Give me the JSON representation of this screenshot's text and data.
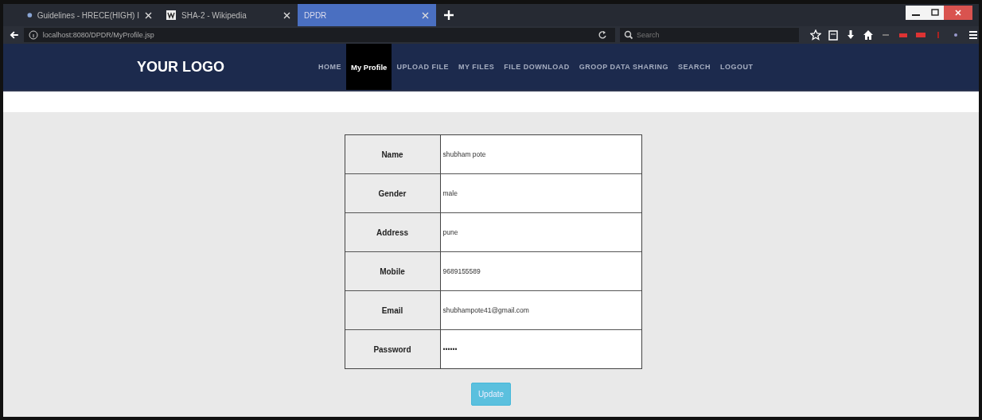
{
  "browser": {
    "tabs": [
      {
        "title": "Guidelines - HRECE(HIGH) I",
        "selected": false
      },
      {
        "title": "SHA-2 - Wikipedia",
        "selected": false
      },
      {
        "title": "DPDR",
        "selected": true
      }
    ],
    "url": "localhost:8080/DPDR/MyProfile.jsp",
    "search": {
      "placeholder": "Search"
    }
  },
  "site": {
    "logo": "YOUR LOGO",
    "nav": [
      {
        "label": "HOME",
        "selected": false
      },
      {
        "label": "My Profile",
        "selected": true
      },
      {
        "label": "UPLOAD FILE",
        "selected": false
      },
      {
        "label": "MY FILES",
        "selected": false
      },
      {
        "label": "FILE DOWNLOAD",
        "selected": false
      },
      {
        "label": "GROOP DATA SHARING",
        "selected": false
      },
      {
        "label": "SEARCH",
        "selected": false
      },
      {
        "label": "LOGOUT",
        "selected": false
      }
    ]
  },
  "profile": {
    "rows": [
      {
        "label": "Name",
        "value": "shubham pote"
      },
      {
        "label": "Gender",
        "value": "male"
      },
      {
        "label": "Address",
        "value": "pune"
      },
      {
        "label": "Mobile",
        "value": "9689155589"
      },
      {
        "label": "Email",
        "value": "shubhampote41@gmail.com"
      },
      {
        "label": "Password",
        "value": "••••••"
      }
    ],
    "button": "Update"
  }
}
